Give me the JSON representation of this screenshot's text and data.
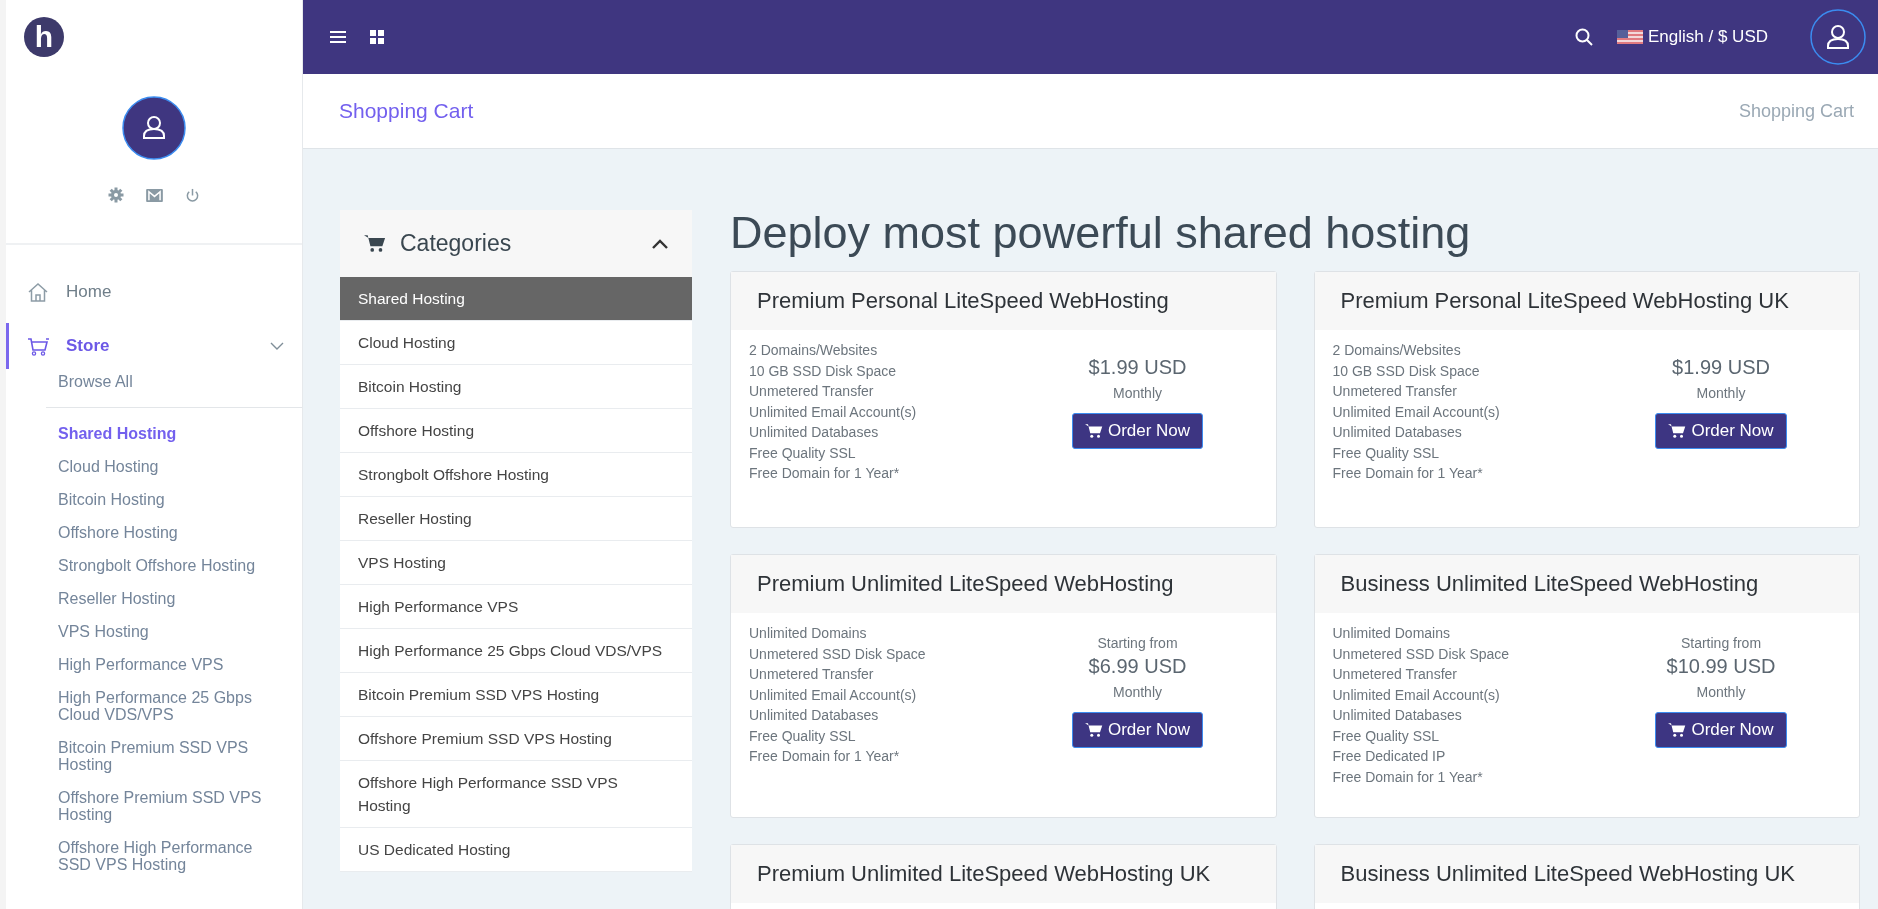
{
  "logo": {
    "letter": "h"
  },
  "topbar": {
    "language": "English / $ USD"
  },
  "sidebar": {
    "home": {
      "label": "Home",
      "selected": false
    },
    "store": {
      "label": "Store",
      "selected": true,
      "expanded": true,
      "browse_all": "Browse All",
      "children": [
        {
          "label": "Shared Hosting",
          "selected": true
        },
        {
          "label": "Cloud Hosting",
          "selected": false
        },
        {
          "label": "Bitcoin Hosting",
          "selected": false
        },
        {
          "label": "Offshore Hosting",
          "selected": false
        },
        {
          "label": "Strongbolt Offshore Hosting",
          "selected": false
        },
        {
          "label": "Reseller Hosting",
          "selected": false
        },
        {
          "label": "VPS Hosting",
          "selected": false
        },
        {
          "label": "High Performance VPS",
          "selected": false
        },
        {
          "label": "High Performance 25 Gbps Cloud VDS/VPS",
          "selected": false
        },
        {
          "label": "Bitcoin Premium SSD VPS Hosting",
          "selected": false
        },
        {
          "label": "Offshore Premium SSD VPS Hosting",
          "selected": false
        },
        {
          "label": "Offshore High Performance SSD VPS Hosting",
          "selected": false
        }
      ]
    }
  },
  "page_header": {
    "title": "Shopping Cart",
    "breadcrumb": "Shopping Cart"
  },
  "categories": {
    "title": "Categories",
    "expanded": true,
    "items": [
      {
        "label": "Shared Hosting",
        "selected": true
      },
      {
        "label": "Cloud Hosting",
        "selected": false
      },
      {
        "label": "Bitcoin Hosting",
        "selected": false
      },
      {
        "label": "Offshore Hosting",
        "selected": false
      },
      {
        "label": "Strongbolt Offshore Hosting",
        "selected": false
      },
      {
        "label": "Reseller Hosting",
        "selected": false
      },
      {
        "label": "VPS Hosting",
        "selected": false
      },
      {
        "label": "High Performance VPS",
        "selected": false
      },
      {
        "label": "High Performance 25 Gbps Cloud VDS/VPS",
        "selected": false
      },
      {
        "label": "Bitcoin Premium SSD VPS Hosting",
        "selected": false
      },
      {
        "label": "Offshore Premium SSD VPS Hosting",
        "selected": false
      },
      {
        "label": "Offshore High Performance SSD VPS Hosting",
        "selected": false
      },
      {
        "label": "US Dedicated Hosting",
        "selected": false
      }
    ]
  },
  "heading": "Deploy most powerful shared hosting",
  "products": [
    {
      "name": "Premium Personal LiteSpeed WebHosting",
      "features": [
        "2 Domains/Websites",
        "10 GB SSD Disk Space",
        "Unmetered Transfer",
        "Unlimited Email Account(s)",
        "Unlimited Databases",
        "Free Quality SSL",
        "Free Domain for 1 Year*"
      ],
      "price": "$1.99 USD",
      "cycle": "Monthly",
      "button": "Order Now"
    },
    {
      "name": "Premium Personal LiteSpeed WebHosting UK",
      "features": [
        "2 Domains/Websites",
        "10 GB SSD Disk Space",
        "Unmetered Transfer",
        "Unlimited Email Account(s)",
        "Unlimited Databases",
        "Free Quality SSL",
        "Free Domain for 1 Year*"
      ],
      "price": "$1.99 USD",
      "cycle": "Monthly",
      "button": "Order Now"
    },
    {
      "name": "Premium Unlimited LiteSpeed WebHosting",
      "features": [
        "Unlimited Domains",
        "Unmetered SSD Disk Space",
        "Unmetered Transfer",
        "Unlimited Email Account(s)",
        "Unlimited Databases",
        "Free Quality SSL",
        "Free Domain for 1 Year*"
      ],
      "price_prefix": "Starting from",
      "price": "$6.99 USD",
      "cycle": "Monthly",
      "button": "Order Now"
    },
    {
      "name": "Business Unlimited LiteSpeed WebHosting",
      "features": [
        "Unlimited Domains",
        "Unmetered SSD Disk Space",
        "Unmetered Transfer",
        "Unlimited Email Account(s)",
        "Unlimited Databases",
        "Free Quality SSL",
        "Free Dedicated IP",
        "Free Domain for 1 Year*"
      ],
      "price_prefix": "Starting from",
      "price": "$10.99 USD",
      "cycle": "Monthly",
      "button": "Order Now"
    },
    {
      "name": "Premium Unlimited LiteSpeed WebHosting UK"
    },
    {
      "name": "Business Unlimited LiteSpeed WebHosting UK"
    }
  ]
}
